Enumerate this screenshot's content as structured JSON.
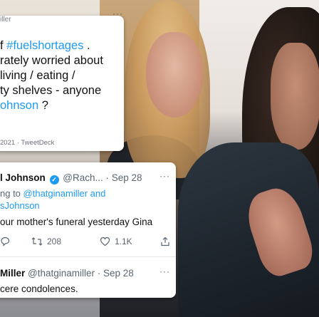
{
  "card1": {
    "handle": "iller",
    "more": "···",
    "lines": [
      {
        "plain": "f ",
        "tag": "#fuelshortages",
        "tail": " ."
      },
      {
        "plain": "rately worried about",
        "tag": "",
        "tail": ""
      },
      {
        "plain": "living / eating /",
        "tag": "",
        "tail": ""
      },
      {
        "plain": "ty shelves - anyone",
        "tag": "",
        "tail": ""
      },
      {
        "plain": "",
        "tag": "ohnson",
        "tail": " ?"
      }
    ],
    "meta": "2021 · TweetDeck"
  },
  "card2": {
    "name": "l Johnson",
    "handle": "@Rach... · Sep 28",
    "more": "···",
    "reply_prefix": "ng to ",
    "reply_tag": "@thatginamiller and",
    "reply_tag2": "sJohnson",
    "text": "our mother's funeral yesterday Gina",
    "actions": {
      "reply": "",
      "retweet": "208",
      "like": "1.1K",
      "share": ""
    }
  },
  "card3": {
    "name": "Miller",
    "handle": "@thatginamiller · Sep 28",
    "more": "···",
    "text": "cere condolences."
  },
  "colors": {
    "accent": "#1d9bf0",
    "text": "#111111",
    "muted": "#5b6570"
  }
}
